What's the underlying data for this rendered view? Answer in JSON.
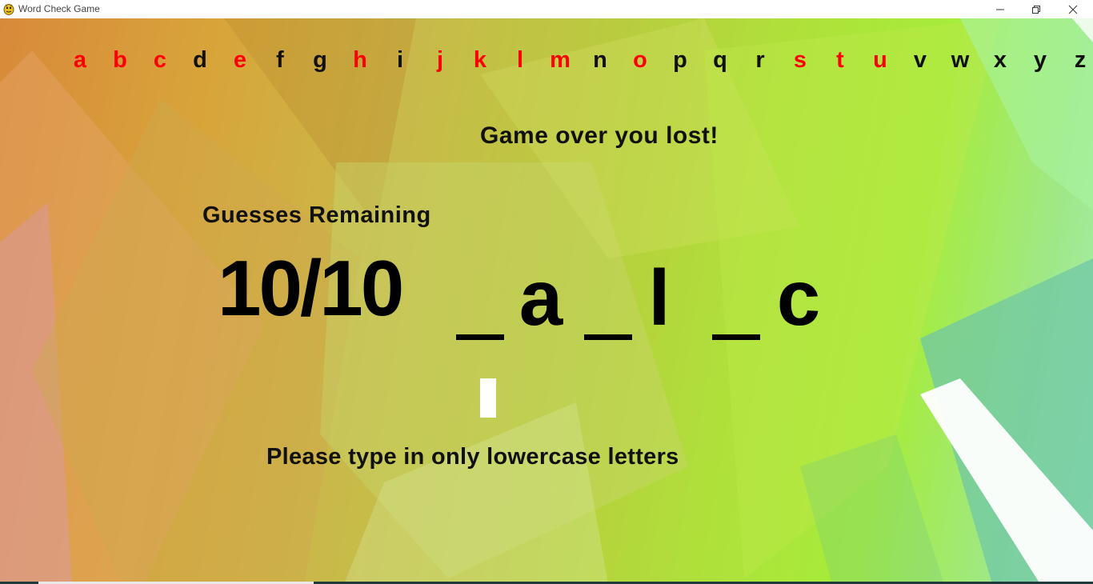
{
  "window": {
    "title": "Word Check Game"
  },
  "alphabet": [
    {
      "letter": "a",
      "used": true
    },
    {
      "letter": "b",
      "used": true
    },
    {
      "letter": "c",
      "used": true
    },
    {
      "letter": "d",
      "used": false
    },
    {
      "letter": "e",
      "used": true
    },
    {
      "letter": "f",
      "used": false
    },
    {
      "letter": "g",
      "used": false
    },
    {
      "letter": "h",
      "used": true
    },
    {
      "letter": "i",
      "used": false
    },
    {
      "letter": "j",
      "used": true
    },
    {
      "letter": "k",
      "used": true
    },
    {
      "letter": "l",
      "used": true
    },
    {
      "letter": "m",
      "used": true
    },
    {
      "letter": "n",
      "used": false
    },
    {
      "letter": "o",
      "used": true
    },
    {
      "letter": "p",
      "used": false
    },
    {
      "letter": "q",
      "used": false
    },
    {
      "letter": "r",
      "used": false
    },
    {
      "letter": "s",
      "used": true
    },
    {
      "letter": "t",
      "used": true
    },
    {
      "letter": "u",
      "used": true
    },
    {
      "letter": "v",
      "used": false
    },
    {
      "letter": "w",
      "used": false
    },
    {
      "letter": "x",
      "used": false
    },
    {
      "letter": "y",
      "used": false
    },
    {
      "letter": "z",
      "used": false
    }
  ],
  "colors": {
    "used_letter": "#ff0000",
    "unused_letter": "#111111"
  },
  "status": {
    "game_over": "Game over you lost!",
    "guesses_label": "Guesses Remaining",
    "guesses_count": "10/10"
  },
  "word_slots": [
    "",
    "a",
    "",
    "l",
    "",
    "c"
  ],
  "instruction": "Please type in only lowercase letters",
  "icons": {
    "app": "pygame-snake-icon",
    "minimize": "minimize-icon",
    "maximize": "restore-icon",
    "close": "close-icon"
  }
}
